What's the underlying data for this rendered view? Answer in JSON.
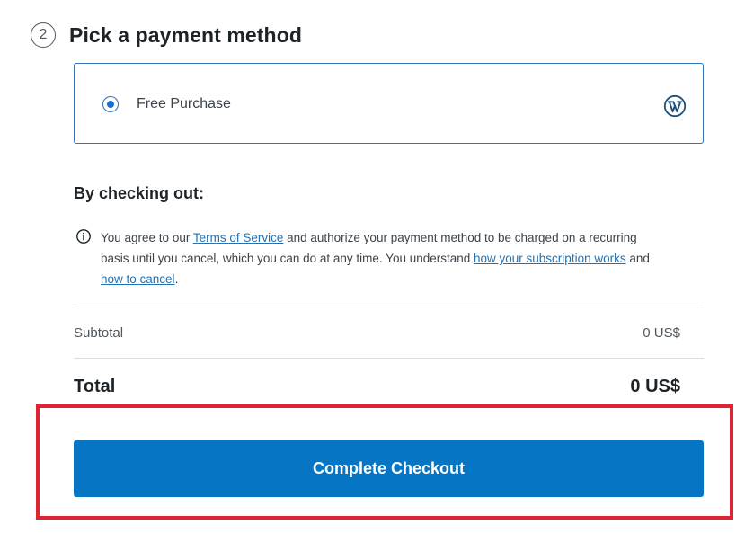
{
  "step": {
    "number": "2",
    "title": "Pick a payment method"
  },
  "payment_method": {
    "label": "Free Purchase",
    "selected": true,
    "icon": "wordpress-logo-icon"
  },
  "checkout_terms": {
    "heading": "By checking out:",
    "info_icon": "info-icon",
    "text_1": "You agree to our ",
    "terms_link": "Terms of Service",
    "text_2": " and authorize your payment method to be charged on a recurring basis until you cancel, which you can do at any time. You understand ",
    "subscription_link": "how your subscription works",
    "text_3": " and ",
    "cancel_link": "how to cancel",
    "text_4": "."
  },
  "summary": {
    "subtotal_label": "Subtotal",
    "subtotal_value": "0 US$",
    "total_label": "Total",
    "total_value": "0 US$"
  },
  "actions": {
    "complete_checkout_label": "Complete Checkout"
  },
  "colors": {
    "accent": "#0675c4",
    "link": "#2271b1",
    "highlight": "#dd2433",
    "selected_border": "#3573b8"
  }
}
